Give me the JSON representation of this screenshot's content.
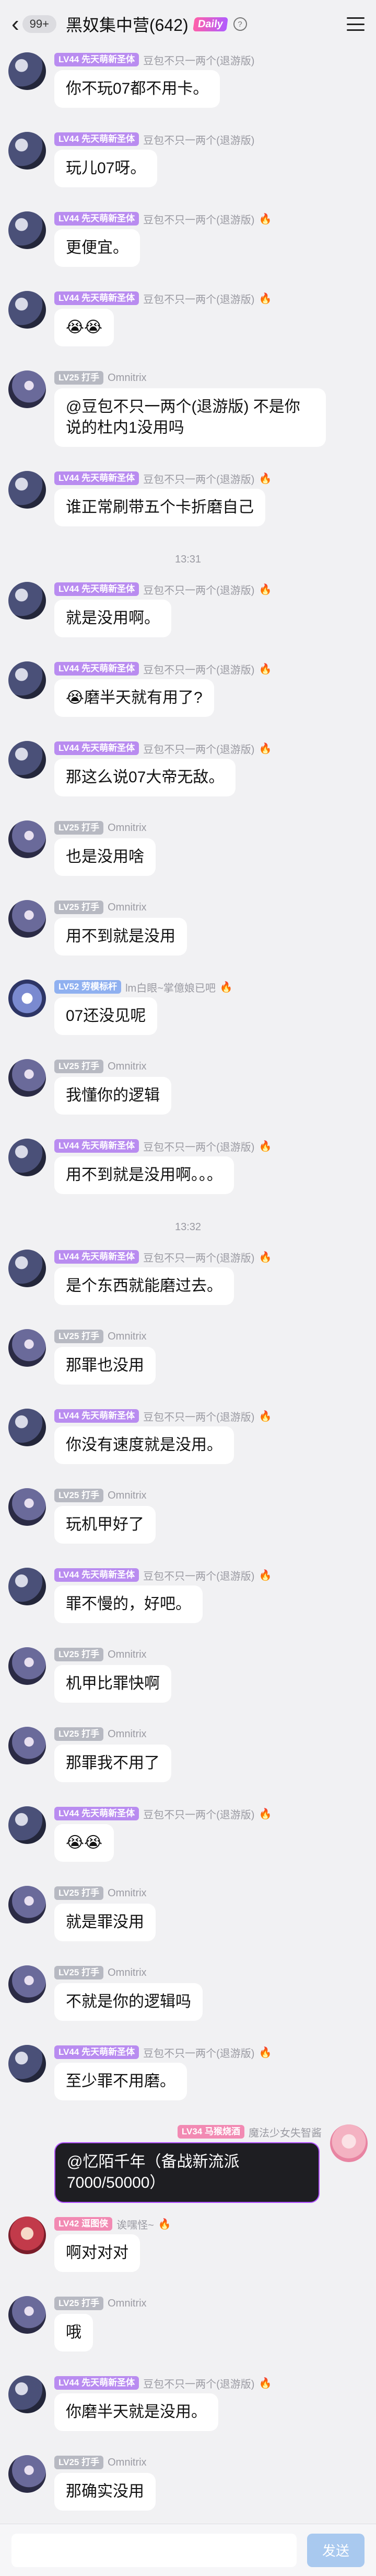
{
  "header": {
    "back_icon": "chevron-left-icon",
    "unread": "99+",
    "title": "黑奴集中营(642)",
    "tag": "Daily",
    "help_icon": "?"
  },
  "timestamps": [
    "13:31",
    "13:32"
  ],
  "messages": [
    {
      "level": "LV44",
      "badge": "先天萌新圣体",
      "name": "豆包不只一两个(退游版)",
      "text": "你不玩07都不用卡。"
    },
    {
      "level": "LV44",
      "badge": "先天萌新圣体",
      "name": "豆包不只一两个(退游版)",
      "text": "玩儿07呀。"
    },
    {
      "level": "LV44",
      "badge": "先天萌新圣体",
      "name": "豆包不只一两个(退游版)",
      "text": "更便宜。"
    },
    {
      "level": "LV44",
      "badge": "先天萌新圣体",
      "name": "豆包不只一两个(退游版)",
      "text": "😭😭"
    },
    {
      "level": "LV25",
      "badge": "打手",
      "name": "Omnitrix",
      "text": "@豆包不只一两个(退游版) 不是你说的杜内1没用吗"
    },
    {
      "level": "LV44",
      "badge": "先天萌新圣体",
      "name": "豆包不只一两个(退游版)",
      "text": "谁正常刷带五个卡折磨自己"
    },
    {
      "level": "LV44",
      "badge": "先天萌新圣体",
      "name": "豆包不只一两个(退游版)",
      "text": "就是没用啊。"
    },
    {
      "level": "LV44",
      "badge": "先天萌新圣体",
      "name": "豆包不只一两个(退游版)",
      "text": "😭磨半天就有用了?"
    },
    {
      "level": "LV44",
      "badge": "先天萌新圣体",
      "name": "豆包不只一两个(退游版)",
      "text": "那这么说07大帝无敌。"
    },
    {
      "level": "LV25",
      "badge": "打手",
      "name": "Omnitrix",
      "text": "也是没用啥"
    },
    {
      "level": "LV25",
      "badge": "打手",
      "name": "Omnitrix",
      "text": "用不到就是没用"
    },
    {
      "level": "LV52",
      "badge": "劳模标杆",
      "name": "lm白眼~掌億娘已吧",
      "text": "07还没见呢"
    },
    {
      "level": "LV25",
      "badge": "打手",
      "name": "Omnitrix",
      "text": "我懂你的逻辑"
    },
    {
      "level": "LV44",
      "badge": "先天萌新圣体",
      "name": "豆包不只一两个(退游版)",
      "text": "用不到就是没用啊。。。"
    },
    {
      "level": "LV44",
      "badge": "先天萌新圣体",
      "name": "豆包不只一两个(退游版)",
      "text": "是个东西就能磨过去。"
    },
    {
      "level": "LV25",
      "badge": "打手",
      "name": "Omnitrix",
      "text": "那罪也没用"
    },
    {
      "level": "LV44",
      "badge": "先天萌新圣体",
      "name": "豆包不只一两个(退游版)",
      "text": "你没有速度就是没用。"
    },
    {
      "level": "LV25",
      "badge": "打手",
      "name": "Omnitrix",
      "text": "玩机甲好了"
    },
    {
      "level": "LV44",
      "badge": "先天萌新圣体",
      "name": "豆包不只一两个(退游版)",
      "text": "罪不慢的，好吧。"
    },
    {
      "level": "LV25",
      "badge": "打手",
      "name": "Omnitrix",
      "text": "机甲比罪快啊"
    },
    {
      "level": "LV25",
      "badge": "打手",
      "name": "Omnitrix",
      "text": "那罪我不用了"
    },
    {
      "level": "LV44",
      "badge": "先天萌新圣体",
      "name": "豆包不只一两个(退游版)",
      "text": "😭😭"
    },
    {
      "level": "LV25",
      "badge": "打手",
      "name": "Omnitrix",
      "text": "就是罪没用"
    },
    {
      "level": "LV25",
      "badge": "打手",
      "name": "Omnitrix",
      "text": "不就是你的逻辑吗"
    },
    {
      "level": "LV44",
      "badge": "先天萌新圣体",
      "name": "豆包不只一两个(退游版)",
      "text": "至少罪不用磨。"
    },
    {
      "level": "LV34",
      "badge": "马猴烧酒",
      "name": "魔法少女失智酱",
      "text": "@忆陌千年（备战新流派7000/50000）"
    },
    {
      "level": "LV42",
      "badge": "逗图侠",
      "name": "诶嘿怪~",
      "text": "啊对对对"
    },
    {
      "level": "LV25",
      "badge": "打手",
      "name": "Omnitrix",
      "text": "哦"
    },
    {
      "level": "LV44",
      "badge": "先天萌新圣体",
      "name": "豆包不只一两个(退游版)",
      "text": "你磨半天就是没用。"
    },
    {
      "level": "LV25",
      "badge": "打手",
      "name": "Omnitrix",
      "text": "那确实没用"
    }
  ],
  "footer": {
    "input_placeholder": "",
    "send_label": "发送"
  },
  "colors": {
    "background": "#f1f1f3",
    "bubble": "#ffffff",
    "send_button": "#a9c9ef",
    "badge_violet": "#b98cf0",
    "badge_gray": "#b7b9c2"
  }
}
